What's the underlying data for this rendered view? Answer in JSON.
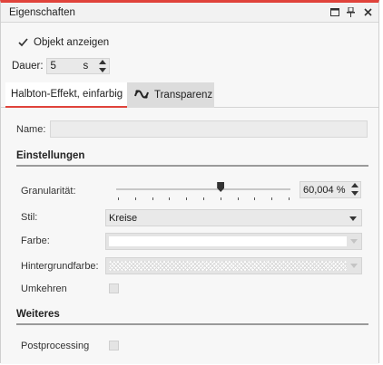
{
  "window": {
    "title": "Eigenschaften",
    "controls": [
      "maximize-icon",
      "pin-icon",
      "close-icon"
    ],
    "accent_color": "#e0433b"
  },
  "show_object": {
    "label": "Objekt anzeigen",
    "checked": true
  },
  "duration": {
    "label": "Dauer:",
    "value": "5",
    "unit": "s"
  },
  "tabs": [
    {
      "label": "Halbton-Effekt, einfarbig",
      "active": true
    },
    {
      "label": "Transparenz",
      "active": false,
      "icon": "transparency-wave-icon"
    }
  ],
  "name": {
    "label": "Name:",
    "value": ""
  },
  "settings": {
    "heading": "Einstellungen",
    "granularity": {
      "label": "Granularität:",
      "value": "60,004 %",
      "fraction": 0.6
    },
    "style": {
      "label": "Stil:",
      "selected": "Kreise"
    },
    "color": {
      "label": "Farbe:",
      "value": "#ffffff"
    },
    "background_color": {
      "label": "Hintergrundfarbe:",
      "value": "transparent"
    },
    "invert": {
      "label": "Umkehren",
      "checked": false
    }
  },
  "more": {
    "heading": "Weiteres",
    "postprocessing": {
      "label": "Postprocessing",
      "checked": false
    }
  }
}
